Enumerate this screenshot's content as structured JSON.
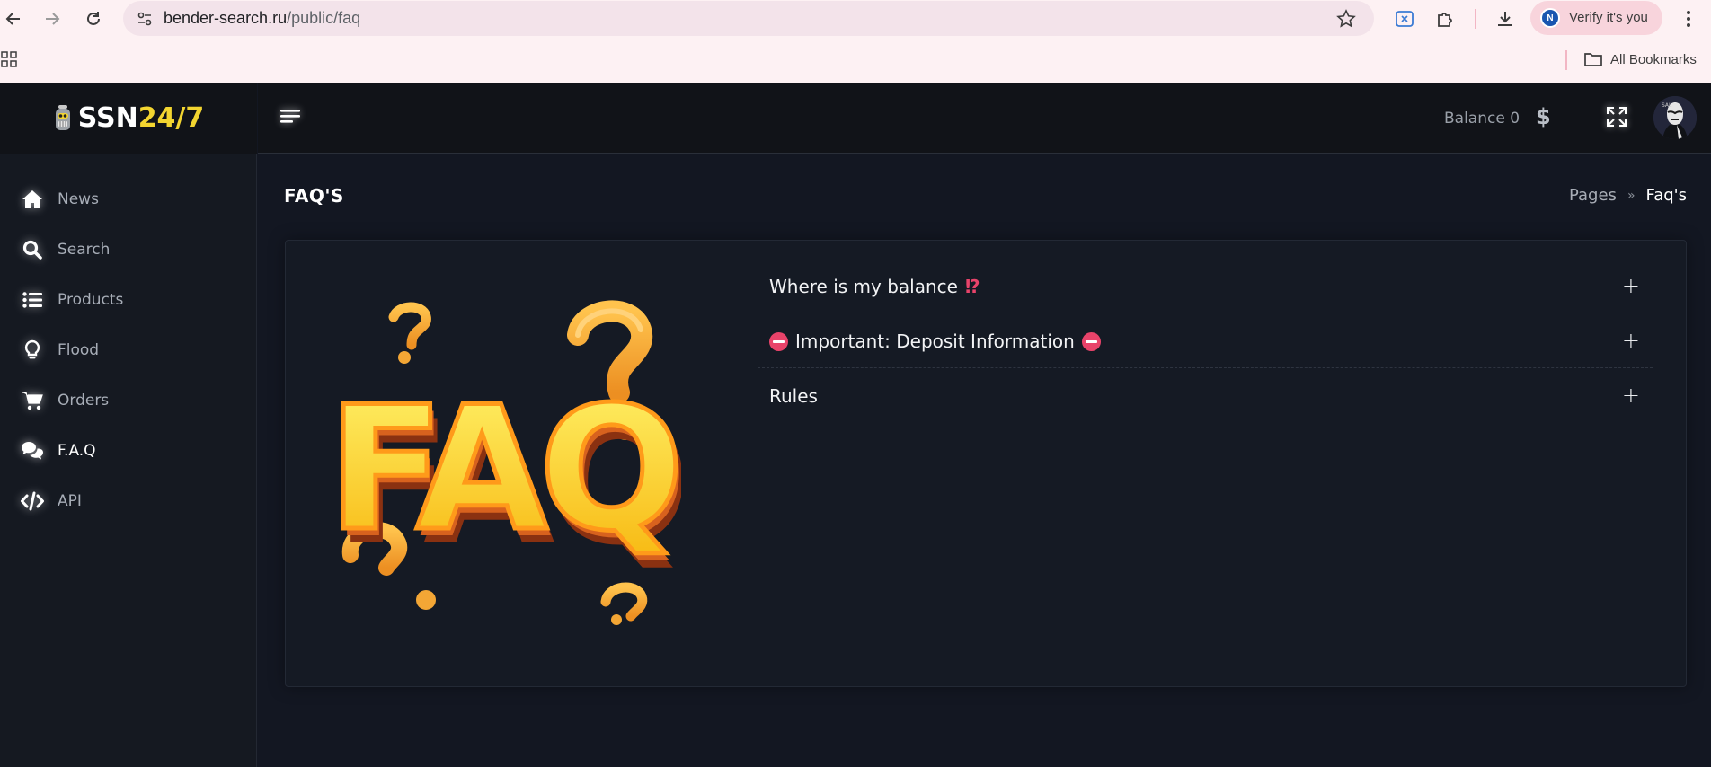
{
  "browser": {
    "url_host": "bender-search.ru",
    "url_path": "/public/faq",
    "profile_initial": "N",
    "profile_label": "Verify it's you",
    "bookmarks_label": "All Bookmarks"
  },
  "brand": {
    "part1": "SSN",
    "part2": "24/7"
  },
  "sidebar": {
    "items": [
      {
        "label": "News",
        "icon": "home-icon"
      },
      {
        "label": "Search",
        "icon": "search-icon"
      },
      {
        "label": "Products",
        "icon": "list-icon"
      },
      {
        "label": "Flood",
        "icon": "lightbulb-icon"
      },
      {
        "label": "Orders",
        "icon": "cart-icon"
      },
      {
        "label": "F.A.Q",
        "icon": "chat-icon",
        "active": true
      },
      {
        "label": "API",
        "icon": "code-icon"
      }
    ]
  },
  "topbar": {
    "balance_label": "Balance 0",
    "currency": "$"
  },
  "page": {
    "title": "FAQ'S",
    "breadcrumb": {
      "parent": "Pages",
      "separator": "»",
      "current": "Faq's"
    }
  },
  "faq": {
    "items": [
      {
        "title": "Where is my balance",
        "suffix": "⁉"
      },
      {
        "title": "Important: Deposit Information"
      },
      {
        "title": "Rules"
      }
    ],
    "toggle": "+"
  },
  "colors": {
    "accent_yellow": "#f3d530",
    "alert_pink": "#e8436a",
    "background": "#131722"
  }
}
